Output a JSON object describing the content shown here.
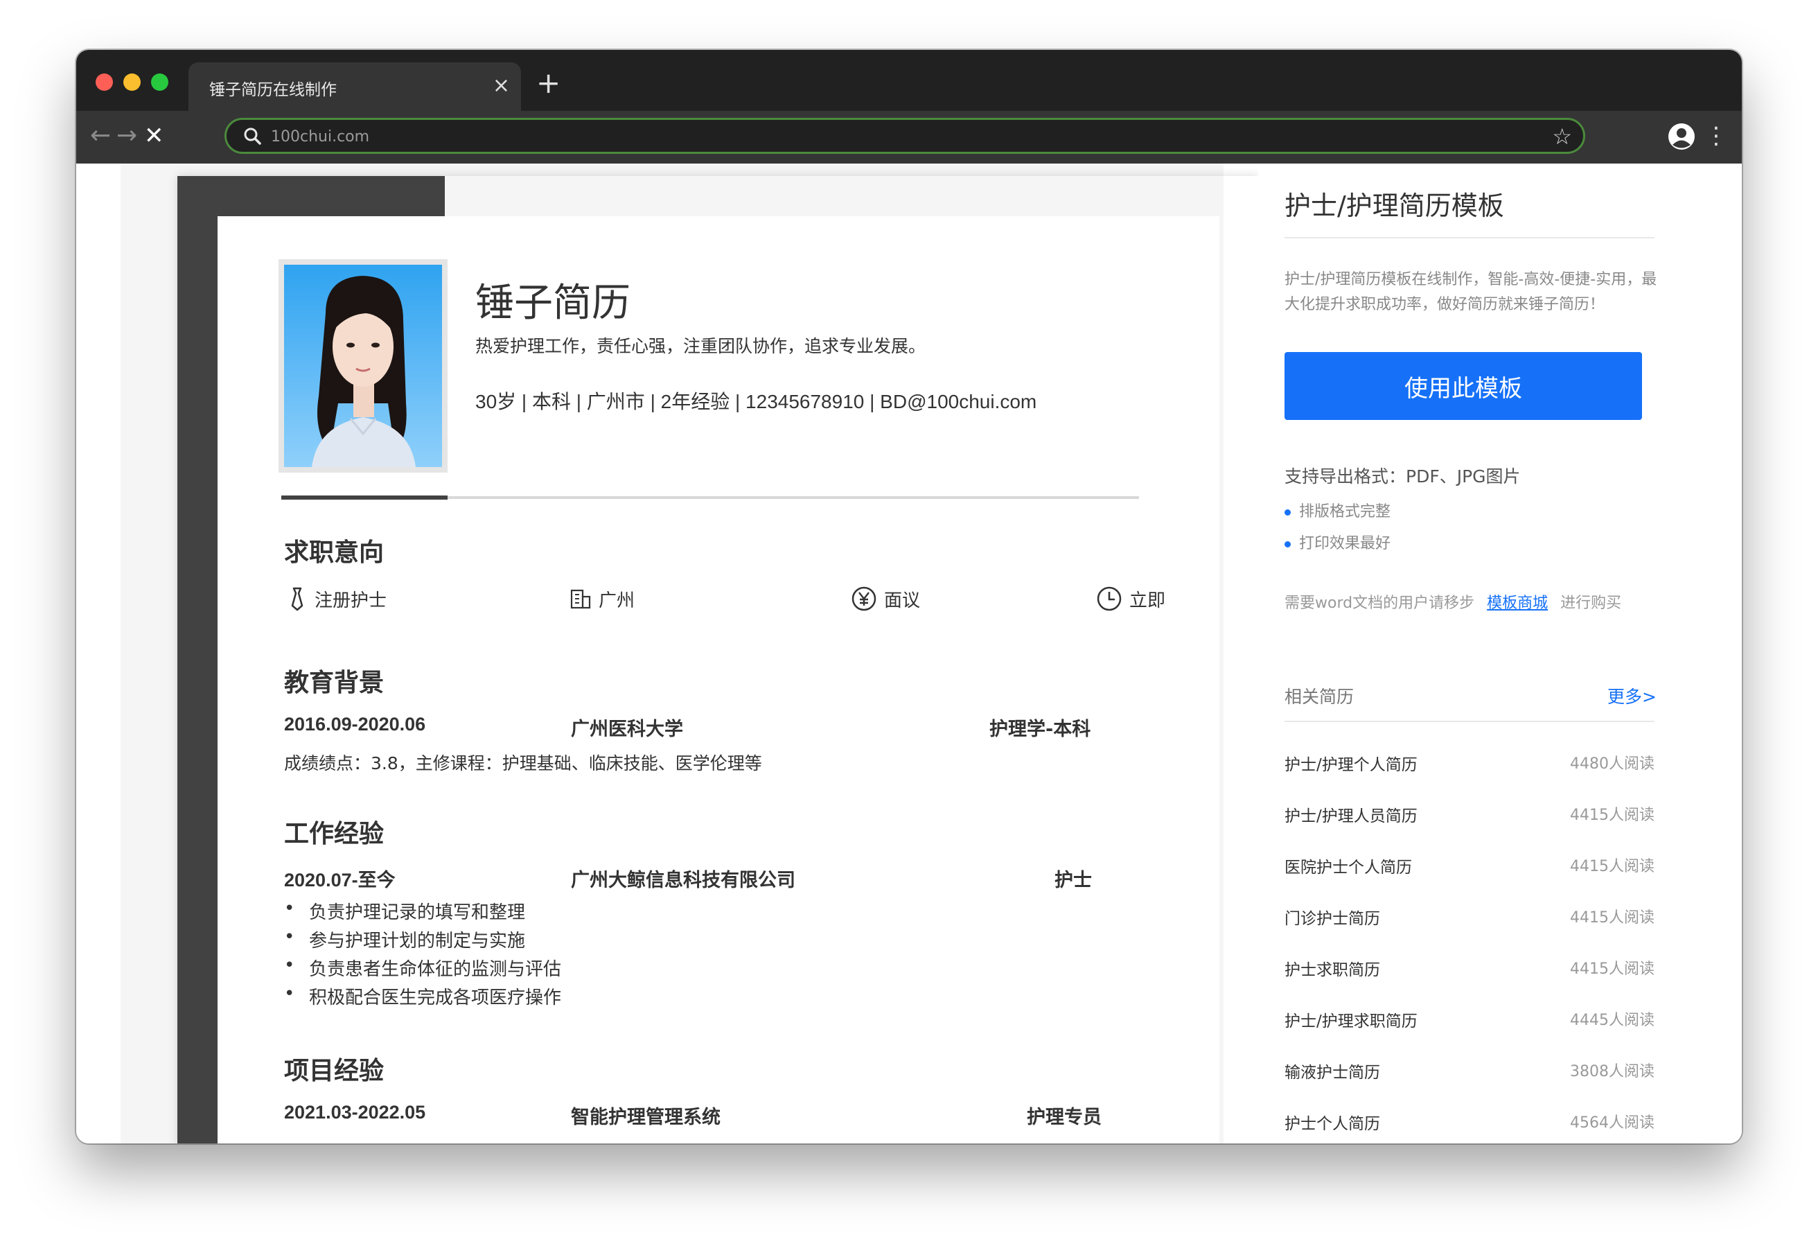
{
  "browser": {
    "tab_title": "锤子简历在线制作",
    "tab_close": "×",
    "new_tab": "+",
    "url": "100chui.com",
    "back": "←",
    "forward": "→",
    "stop": "✕",
    "star": "☆",
    "menu": "⋮"
  },
  "resume": {
    "name": "锤子简历",
    "motto": "热爱护理工作，责任心强，注重团队协作，追求专业发展。",
    "info": "30岁 | 本科 | 广州市 | 2年经验 | 12345678910 | BD@100chui.com",
    "sections": {
      "intent": "求职意向",
      "education": "教育背景",
      "work": "工作经验",
      "project": "项目经验"
    },
    "intent": {
      "position": "注册护士",
      "city": "广州",
      "salary": "面议",
      "arrival": "立即",
      "icons": [
        "tie-icon",
        "building-icon",
        "yen-icon",
        "clock-icon"
      ]
    },
    "education": {
      "date": "2016.09-2020.06",
      "school": "广州医科大学",
      "major": "护理学-本科",
      "detail": "成绩绩点：3.8，主修课程：护理基础、临床技能、医学伦理等"
    },
    "work": {
      "date": "2020.07-至今",
      "company": "广州大鲸信息科技有限公司",
      "role": "护士",
      "bullets": [
        "负责护理记录的填写和整理",
        "参与护理计划的制定与实施",
        "负责患者生命体征的监测与评估",
        "积极配合医生完成各项医疗操作"
      ]
    },
    "project": {
      "date": "2021.03-2022.05",
      "name": "智能护理管理系统",
      "role": "护理专员"
    }
  },
  "sidebar": {
    "title": "护士/护理简历模板",
    "description": "护士/护理简历模板在线制作，智能-高效-便捷-实用，最大化提升求职成功率，做好简历就来锤子简历！",
    "use_button": "使用此模板",
    "export_formats": "支持导出格式：PDF、JPG图片",
    "features": [
      "排版格式完整",
      "打印效果最好"
    ],
    "word_prefix": "需要word文档的用户请移步",
    "word_link": "模板商城",
    "word_suffix": "进行购买",
    "related_title": "相关简历",
    "more": "更多>",
    "accent_color": "#1671f8",
    "related": [
      {
        "name": "护士/护理个人简历",
        "views": "4480人阅读"
      },
      {
        "name": "护士/护理人员简历",
        "views": "4415人阅读"
      },
      {
        "name": "医院护士个人简历",
        "views": "4415人阅读"
      },
      {
        "name": "门诊护士简历",
        "views": "4415人阅读"
      },
      {
        "name": "护士求职简历",
        "views": "4415人阅读"
      },
      {
        "name": "护士/护理求职简历",
        "views": "4445人阅读"
      },
      {
        "name": "输液护士简历",
        "views": "3808人阅读"
      },
      {
        "name": "护士个人简历",
        "views": "4564人阅读"
      }
    ]
  }
}
